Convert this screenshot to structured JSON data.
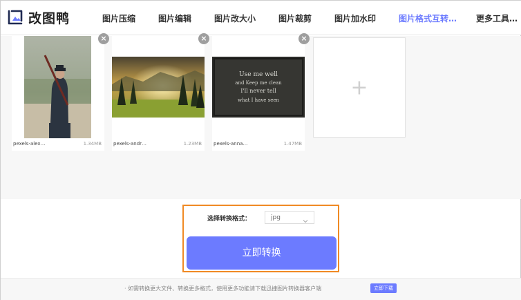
{
  "app": {
    "name": "改图鸭",
    "accent_color": "#6c7bff",
    "logo_icon": "image-frame-icon"
  },
  "nav": [
    {
      "label": "图片压缩",
      "active": false
    },
    {
      "label": "图片编辑",
      "active": false
    },
    {
      "label": "图片改大小",
      "active": false
    },
    {
      "label": "图片裁剪",
      "active": false
    },
    {
      "label": "图片加水印",
      "active": false
    },
    {
      "label": "图片格式互转…",
      "active": true
    },
    {
      "label": "更多工具…",
      "active": false
    }
  ],
  "files": [
    {
      "name": "pexels-alex…",
      "size": "1.34MB"
    },
    {
      "name": "pexels-andr…",
      "size": "1.23MB"
    },
    {
      "name": "pexels-anna…",
      "size": "1.47MB"
    }
  ],
  "chalkboard": {
    "lines": [
      "Use me well",
      "and Keep me clean",
      "I'll never tell",
      "what I have seen"
    ]
  },
  "add_card": {
    "icon": "plus-icon",
    "glyph": "+"
  },
  "remove_glyph": "×",
  "convert": {
    "format_label": "选择转换格式：",
    "format_value": "jpg",
    "button_label": "立即转换",
    "highlight_color": "#f08a24"
  },
  "footer": {
    "note": "· 如需转换更大文件、转换更多格式，使用更多功能请下载迅捷图片转换器客户端",
    "download_label": "立即下载"
  }
}
